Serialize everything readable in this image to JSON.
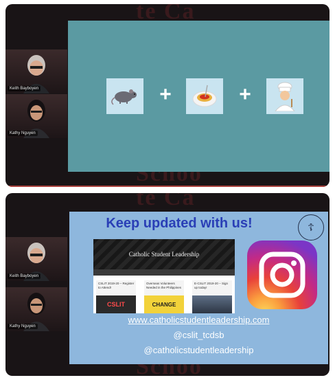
{
  "panel_top": {
    "participants": [
      {
        "name": "Keith Bayboyen"
      },
      {
        "name": "Kathy Nguyen"
      }
    ],
    "slide": {
      "bg_color": "#5b9aa2",
      "items": [
        {
          "icon": "rat-icon"
        },
        {
          "operator": "+"
        },
        {
          "icon": "spaghetti-icon"
        },
        {
          "operator": "+"
        },
        {
          "icon": "chef-icon"
        }
      ]
    }
  },
  "panel_bottom": {
    "participants": [
      {
        "name": "Keith Bayboyen"
      },
      {
        "name": "Kathy Nguyen"
      }
    ],
    "slide": {
      "bg_color": "#8eb7dd",
      "headline": "Keep updated with us!",
      "website_preview": {
        "title": "Catholic Student Leadership",
        "cards": [
          {
            "title": "CSLIT 2019-20 – Register to Attend!"
          },
          {
            "title": "Overseas Volunteers Needed in the Philippines"
          },
          {
            "title": "E-CSLIT 2019-20 – Sign up today!"
          }
        ],
        "card_images": [
          "CSLIT",
          "CHANGE"
        ]
      },
      "instagram_icon": "instagram-icon",
      "links": {
        "url": "www.catholicstudentleadership.com",
        "handle_1": "@cslit_tcdsb",
        "handle_2": "@catholicstudentleadership"
      }
    }
  },
  "background_letters": [
    "te Ca",
    "Schoo",
    "te Ca",
    "Schoo"
  ],
  "colors": {
    "frame": "#191416",
    "red_line": "#a9403c",
    "headline": "#2a3fb6"
  }
}
